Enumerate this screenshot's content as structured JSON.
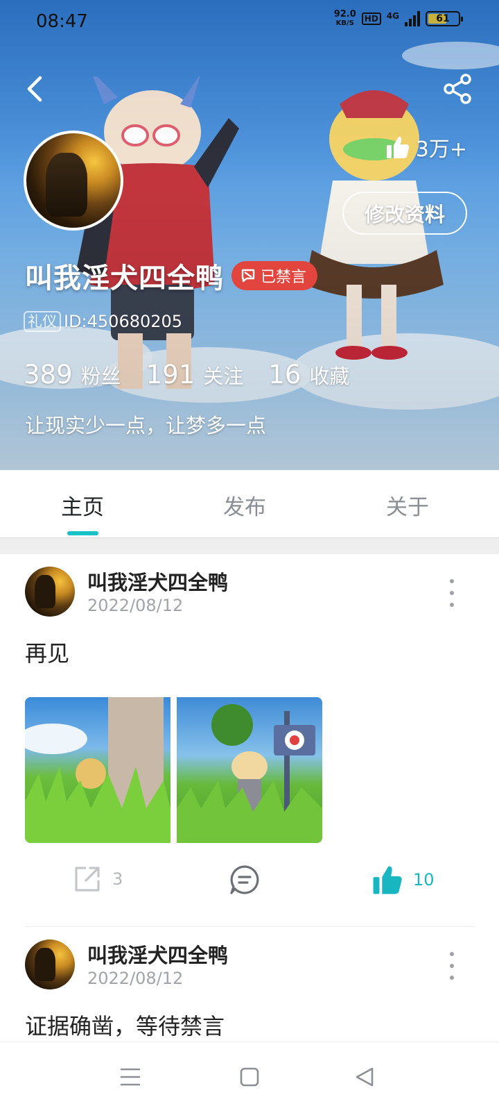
{
  "status_bar": {
    "time": "08:47",
    "net_speed_value": "92.0",
    "net_speed_unit": "KB/S",
    "hd": "HD",
    "network": "4G",
    "battery": "61",
    "battery_level": 0.61
  },
  "profile": {
    "likes": "3万+",
    "edit_label": "修改资料",
    "username": "叫我淫犬四全鸭",
    "banned_label": "已禁言",
    "etiquette_tag": "礼仪",
    "user_id": "ID:450680205",
    "stats": [
      {
        "value": "389",
        "label": "粉丝"
      },
      {
        "value": "191",
        "label": "关注"
      },
      {
        "value": "16",
        "label": "收藏"
      }
    ],
    "bio": "让现实少一点，让梦多一点"
  },
  "tabs": [
    {
      "label": "主页",
      "active": true
    },
    {
      "label": "发布",
      "active": false
    },
    {
      "label": "关于",
      "active": false
    }
  ],
  "posts": [
    {
      "author": "叫我淫犬四全鸭",
      "date": "2022/08/12",
      "text": "再见",
      "share_count": "3",
      "like_count": "10"
    },
    {
      "author": "叫我淫犬四全鸭",
      "date": "2022/08/12",
      "text": "证据确凿，等待禁言"
    }
  ],
  "colors": {
    "accent": "#18c0c7",
    "banned_badge": "#e2453d"
  },
  "icons": [
    "back-arrow-icon",
    "share-icon",
    "thumbs-up-icon",
    "comment-icon",
    "external-share-icon",
    "more-vert-icon",
    "menu-icon",
    "home-square-icon",
    "back-triangle-icon"
  ]
}
